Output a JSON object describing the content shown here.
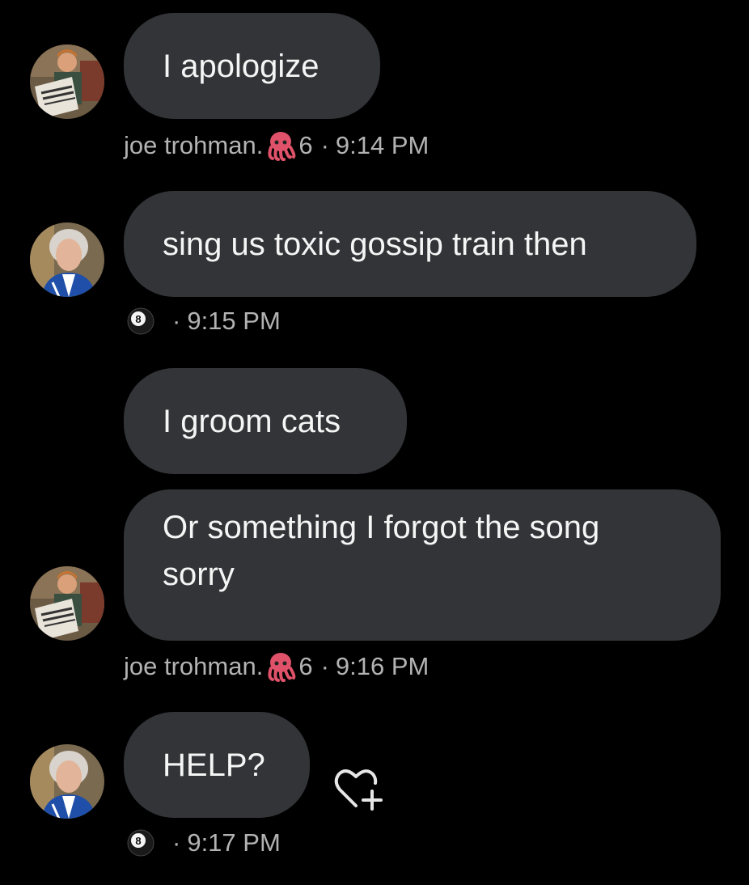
{
  "messages": [
    {
      "text": "I apologize",
      "sender": "joe trohman.",
      "sender_emoji": "octopus-icon",
      "sender_number": "6",
      "separator": "·",
      "time": "9:14 PM",
      "avatar": "conan-newspaper-avatar"
    },
    {
      "text": "sing us toxic gossip train then",
      "sender_emoji": "8-ball-icon",
      "separator": "·",
      "time": "9:15 PM",
      "avatar": "woman-avatar"
    },
    {
      "text": "I groom cats"
    },
    {
      "text_line1": "Or something I forgot the song",
      "text_line2": "sorry",
      "sender": "joe trohman.",
      "sender_emoji": "octopus-icon",
      "sender_number": "6",
      "separator": "·",
      "time": "9:16 PM",
      "avatar": "conan-newspaper-avatar"
    },
    {
      "text": "HELP?",
      "sender_emoji": "8-ball-icon",
      "separator": "·",
      "time": "9:17 PM",
      "avatar": "woman-avatar",
      "reaction_button": "heart-plus-icon"
    }
  ],
  "colors": {
    "background": "#000000",
    "bubble": "#323437",
    "meta_text": "#b3b3b3",
    "octopus": "#e0526a"
  }
}
